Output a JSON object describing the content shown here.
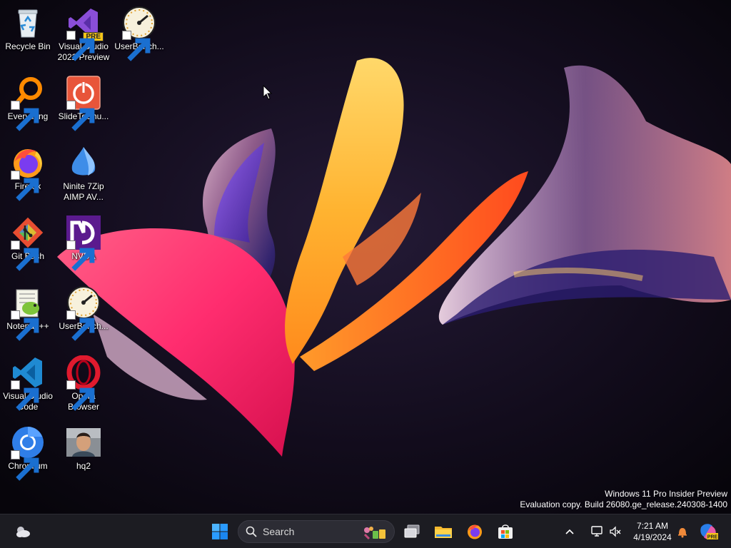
{
  "desktop": {
    "icons": [
      {
        "label": "Recycle Bin",
        "icon": "recycle-bin-icon"
      },
      {
        "label": "Visual Studio\n2022 Preview",
        "icon": "visual-studio-icon",
        "badge": "PRE"
      },
      {
        "label": "UserBench...",
        "icon": "gauge-icon"
      },
      {
        "label": "Everything",
        "icon": "magnifier-icon"
      },
      {
        "label": "SlideToShu...",
        "icon": "power-icon"
      },
      {
        "label": "Firefox",
        "icon": "firefox-icon"
      },
      {
        "label": "Ninite 7Zip\nAIMP AV...",
        "icon": "ninite-icon"
      },
      {
        "label": "Git Bash",
        "icon": "git-icon"
      },
      {
        "label": "NVDA",
        "icon": "nvda-icon"
      },
      {
        "label": "Notepad++",
        "icon": "notepad-plus-plus-icon"
      },
      {
        "label": "UserBench...",
        "icon": "gauge-icon"
      },
      {
        "label": "Visual Studio\nCode",
        "icon": "vscode-icon"
      },
      {
        "label": "Opera\nBrowser",
        "icon": "opera-icon"
      },
      {
        "label": "Chromium",
        "icon": "chromium-icon"
      },
      {
        "label": "hq2",
        "icon": "photo-thumbnail-icon"
      }
    ]
  },
  "watermark": {
    "line1": "Windows 11 Pro Insider Preview",
    "line2": "Evaluation copy. Build 26080.ge_release.240308-1400"
  },
  "taskbar": {
    "search_placeholder": "Search",
    "pinned": [
      "widgets-icon",
      "start-icon",
      "task-view-icon",
      "file-explorer-icon",
      "firefox-icon",
      "store-icon"
    ],
    "tray": {
      "time": "7:21 AM",
      "date": "4/19/2024"
    }
  },
  "colors": {
    "taskbar_bg": "#1c1c22",
    "search_bg": "#2c2c34",
    "start_blue": "#3aa0ff",
    "desktop_bg": "#0a0610"
  }
}
